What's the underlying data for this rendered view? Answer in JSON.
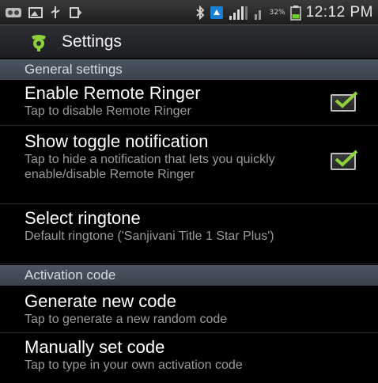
{
  "statusbar": {
    "time": "12:12 PM",
    "battery_percent": "32%",
    "icons": [
      "notification-icon",
      "image-icon",
      "usb-icon",
      "sync-icon",
      "bluetooth-icon",
      "network-icon",
      "signal-icon",
      "battery-icon"
    ]
  },
  "appbar": {
    "title": "Settings",
    "icon": "remote-ringer-app-icon"
  },
  "sections": {
    "general": {
      "header": "General settings",
      "enable_remote_ringer": {
        "title": "Enable Remote Ringer",
        "summary": "Tap to disable Remote Ringer",
        "checked": true
      },
      "show_toggle_notification": {
        "title": "Show toggle notification",
        "summary": "Tap to hide a notification that lets you quickly enable/disable Remote Ringer",
        "checked": true
      },
      "select_ringtone": {
        "title": "Select ringtone",
        "summary": "Default ringtone ('Sanjivani Title 1 Star Plus')"
      }
    },
    "activation": {
      "header": "Activation code",
      "generate_new_code": {
        "title": "Generate new code",
        "summary": "Tap to generate a new random code"
      },
      "manually_set_code": {
        "title": "Manually set code",
        "summary": "Tap to type in your own activation code"
      }
    }
  },
  "colors": {
    "checkmark": "#8fd13a",
    "category_bg": "#444b57",
    "background": "#000000"
  }
}
